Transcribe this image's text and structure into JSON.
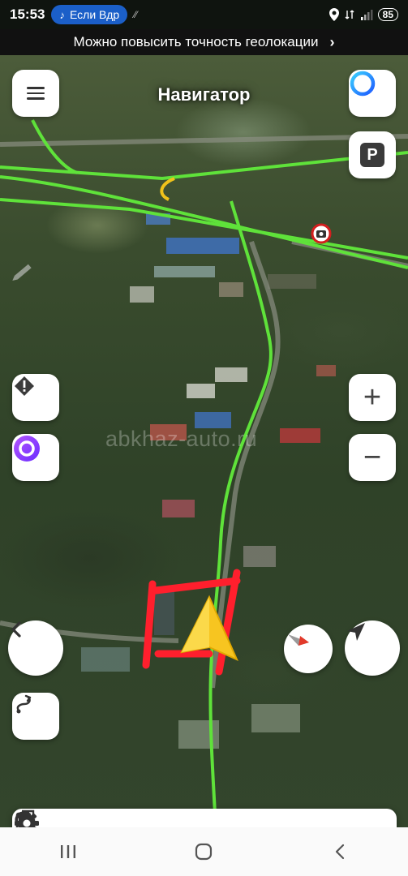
{
  "status_bar": {
    "time": "15:53",
    "music_title": "Если Вдр",
    "battery": "85"
  },
  "banner": {
    "text": "Можно повысить точность геолокации",
    "chevron": "›"
  },
  "map": {
    "title": "Навигатор",
    "watermark": "abkhaz-auto.ru",
    "route_color": "#5fe23a",
    "arrow_color": "#f7c520",
    "annotation_color": "#ff1f2d"
  },
  "buttons": {
    "menu": "menu-icon",
    "alice_top": "alice-icon",
    "parking": "P",
    "alert": "alert-icon",
    "alice": "alice-icon",
    "zoom_in": "+",
    "zoom_out": "−",
    "back": "chevron-left-icon",
    "compass": "compass-icon",
    "locate": "locate-icon",
    "route": "route-icon"
  },
  "toolbar": {
    "items": [
      "search-icon",
      "gas-station-icon",
      "bookmarks-icon",
      "settings-icon"
    ]
  },
  "nav_bar": {
    "items": [
      "recent-apps-icon",
      "home-icon",
      "back-icon"
    ]
  }
}
